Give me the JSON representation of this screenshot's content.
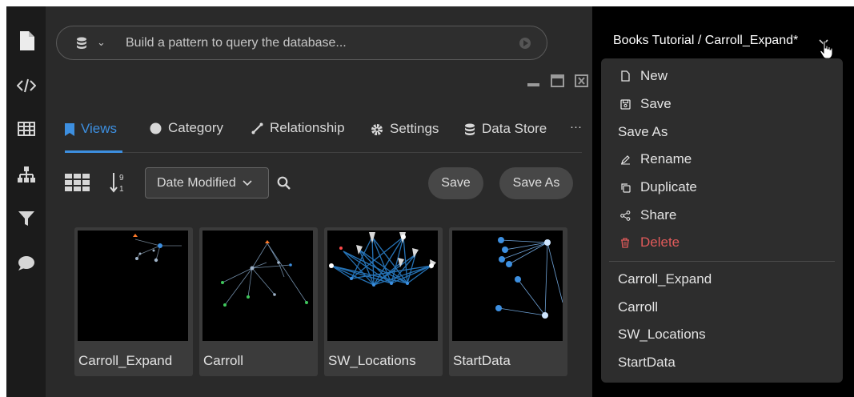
{
  "sidebar": {
    "icons": [
      "file-icon",
      "code-icon",
      "table-icon",
      "hierarchy-icon",
      "filter-icon",
      "chat-icon"
    ]
  },
  "query": {
    "placeholder": "Build a pattern to query the database..."
  },
  "tabs": [
    {
      "label": "Views",
      "icon": "bookmark-icon",
      "active": true
    },
    {
      "label": "Category",
      "icon": "circle-icon"
    },
    {
      "label": "Relationship",
      "icon": "line-icon"
    },
    {
      "label": "Settings",
      "icon": "gear-icon"
    },
    {
      "label": "Data Store",
      "icon": "database-icon"
    },
    {
      "label": "···",
      "icon": "more-icon"
    }
  ],
  "toolbar": {
    "sort_select": "Date Modified",
    "save_label": "Save",
    "save_as_label": "Save As"
  },
  "cards": [
    {
      "label": "Carroll_Expand"
    },
    {
      "label": "Carroll"
    },
    {
      "label": "SW_Locations"
    },
    {
      "label": "StartData"
    }
  ],
  "header": {
    "breadcrumb": "Books Tutorial / Carroll_Expand*"
  },
  "menu": {
    "actions": [
      {
        "label": "New",
        "icon": "file-icon"
      },
      {
        "label": "Save",
        "icon": "save-icon"
      },
      {
        "label": "Save As",
        "icon": ""
      },
      {
        "label": "Rename",
        "icon": "pencil-icon"
      },
      {
        "label": "Duplicate",
        "icon": "copy-icon"
      },
      {
        "label": "Share",
        "icon": "share-icon"
      },
      {
        "label": "Delete",
        "icon": "trash-icon",
        "danger": true
      }
    ],
    "views": [
      "Carroll_Expand",
      "Carroll",
      "SW_Locations",
      "StartData"
    ]
  },
  "colors": {
    "accent": "#3d8fe0",
    "danger": "#e05a5a",
    "panel": "#2d2d2d"
  }
}
